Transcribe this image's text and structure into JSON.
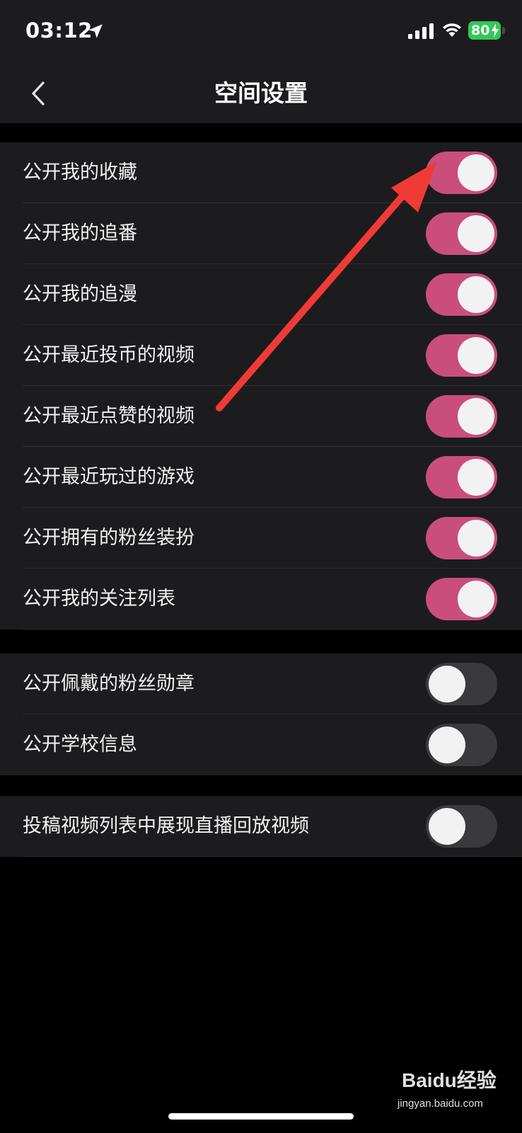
{
  "status_bar": {
    "time": "03:12",
    "battery": "80"
  },
  "nav": {
    "title": "空间设置"
  },
  "groups": [
    {
      "items": [
        {
          "label": "公开我的收藏",
          "on": true
        },
        {
          "label": "公开我的追番",
          "on": true
        },
        {
          "label": "公开我的追漫",
          "on": true
        },
        {
          "label": "公开最近投币的视频",
          "on": true
        },
        {
          "label": "公开最近点赞的视频",
          "on": true
        },
        {
          "label": "公开最近玩过的游戏",
          "on": true
        },
        {
          "label": "公开拥有的粉丝装扮",
          "on": true
        },
        {
          "label": "公开我的关注列表",
          "on": true
        }
      ]
    },
    {
      "items": [
        {
          "label": "公开佩戴的粉丝勋章",
          "on": false
        },
        {
          "label": "公开学校信息",
          "on": false
        }
      ]
    },
    {
      "items": [
        {
          "label": "投稿视频列表中展现直播回放视频",
          "on": false
        }
      ]
    }
  ],
  "colors": {
    "toggle_on": "#c94e7c",
    "toggle_off": "#3a3a3d",
    "annotation_arrow": "#f03a36",
    "battery": "#34c759"
  },
  "watermark": {
    "logo": "Baidu经验",
    "url": "jingyan.baidu.com"
  }
}
